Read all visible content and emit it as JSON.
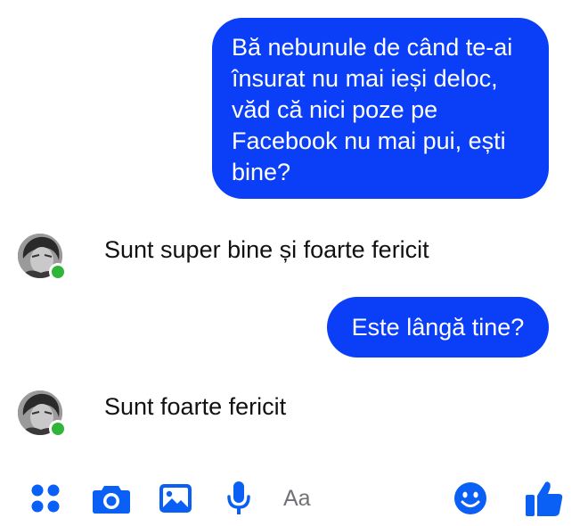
{
  "colors": {
    "outgoing_bubble": "#0a3ff7",
    "accent": "#0a5ff5",
    "presence": "#31b43a"
  },
  "messages": [
    {
      "direction": "outgoing",
      "lines": [
        "Bă nebunule de când te-ai",
        "însurat nu mai ieși deloc,",
        "văd că nici poze pe",
        "Facebook nu mai pui, ești",
        "bine?"
      ]
    },
    {
      "direction": "incoming",
      "text": "Sunt super bine și foarte fericit"
    },
    {
      "direction": "outgoing",
      "text": "Este lângă tine?"
    },
    {
      "direction": "incoming",
      "text": "Sunt foarte fericit"
    }
  ],
  "composer": {
    "placeholder": "Aa",
    "icons": [
      "more-dots-icon",
      "camera-icon",
      "gallery-icon",
      "microphone-icon",
      "emoji-icon",
      "thumbs-up-icon"
    ]
  }
}
